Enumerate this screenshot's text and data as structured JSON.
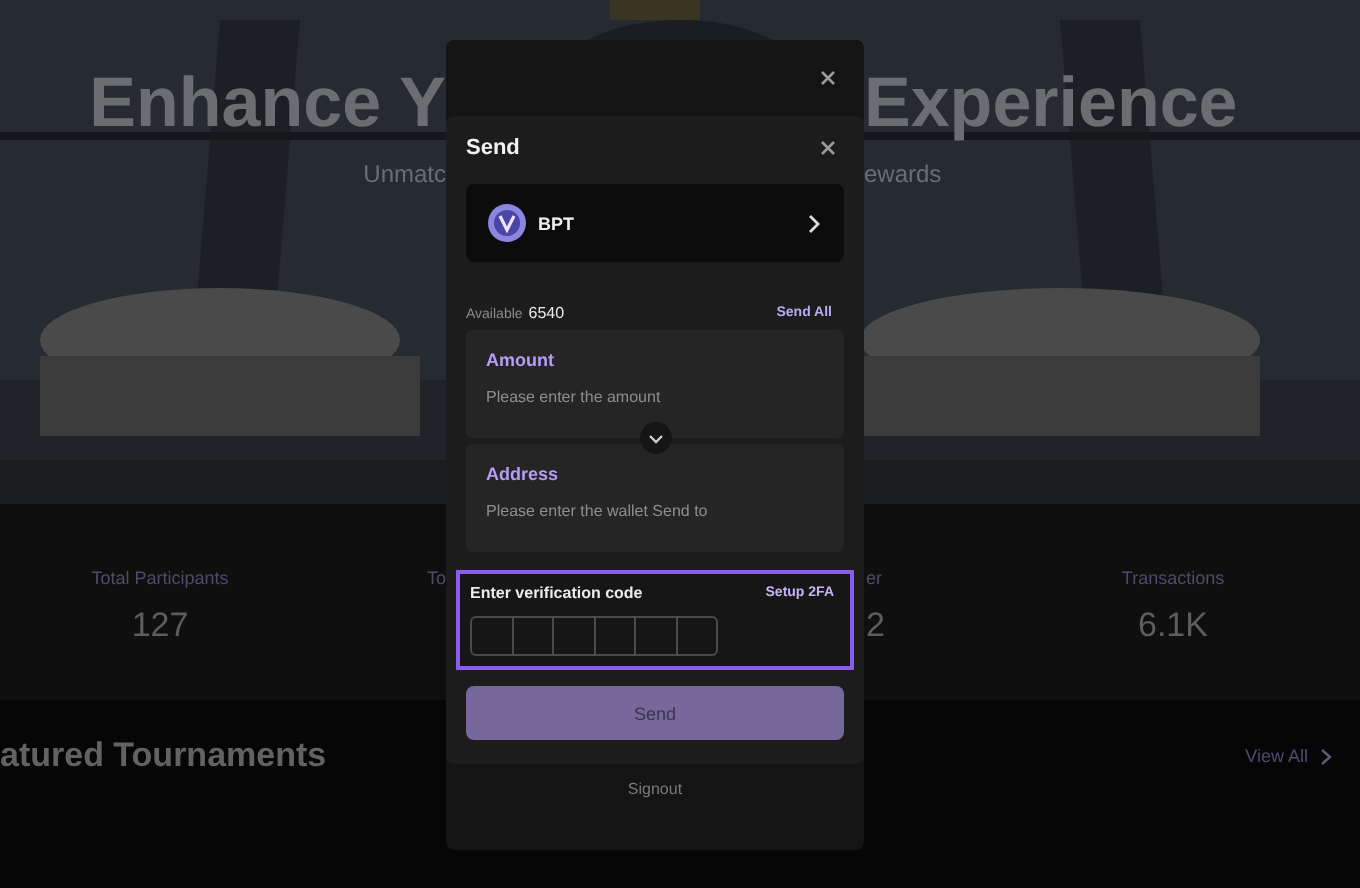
{
  "page": {
    "hero": {
      "title": [
        "Enhance Y",
        "Experience"
      ],
      "subtitle": [
        "Unmatc",
        "ewards"
      ]
    },
    "stats": [
      {
        "label": "Total Participants",
        "value": "127"
      },
      {
        "label": "To"
      },
      {
        "label": "er",
        "value": "2"
      },
      {
        "label": "Transactions",
        "value": "6.1K"
      }
    ],
    "featured": {
      "title": "atured Tournaments",
      "link": "View All"
    }
  },
  "modal": {
    "send": {
      "title": "Send",
      "token": {
        "name": "BPT"
      },
      "available_label": "Available",
      "available_value": "6540",
      "send_all": "Send All",
      "amount": {
        "label": "Amount",
        "placeholder": "Please enter the amount"
      },
      "address": {
        "label": "Address",
        "placeholder": "Please enter the wallet Send to"
      },
      "verification": {
        "label": "Enter verification code",
        "link": "Setup 2FA",
        "focused": true
      },
      "button": {
        "label": "Send",
        "disabled": true
      }
    },
    "signout": "Signout"
  }
}
